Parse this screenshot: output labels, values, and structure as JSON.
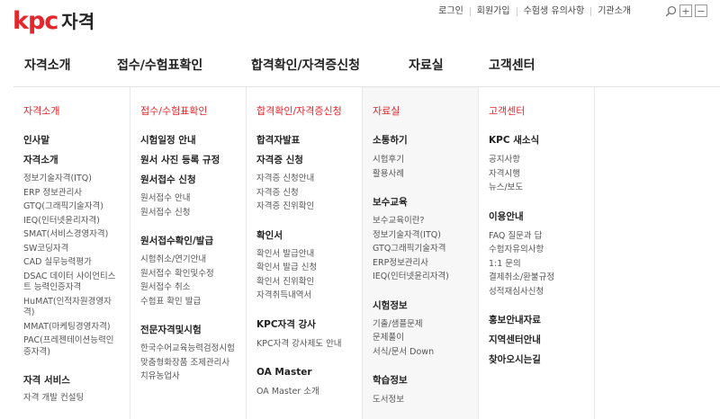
{
  "logo": {
    "mark": "kpc",
    "text": "자격"
  },
  "util_links": [
    "로그인",
    "회원가입",
    "수험생 유의사항",
    "기관소개"
  ],
  "gnb": [
    "자격소개",
    "접수/수험표확인",
    "합격확인/자격증신청",
    "자료실",
    "고객센터"
  ],
  "columns": [
    {
      "title": "자격소개",
      "groups": [
        {
          "heading": "인사말",
          "links": []
        },
        {
          "heading": "자격소개",
          "links": [
            "정보기술자격(ITQ)",
            "ERP 정보관리사",
            "GTQ(그래픽기술자격)",
            "IEQ(인터넷윤리자격)",
            "SMAT(서비스경영자격)",
            "SW코딩자격",
            "CAD 실무능력평가",
            "DSAC 데이터 사이언티스트 능력인증자격",
            "HuMAT(인적자원경영자격)",
            "MMAT(마케팅경영자격)",
            "PAC(프레젠테이션능력인증자격)"
          ]
        },
        {
          "heading": "자격 서비스",
          "links": [
            "자격 개발 컨설팅"
          ]
        }
      ]
    },
    {
      "title": "접수/수험표확인",
      "groups": [
        {
          "heading": "시험일정 안내",
          "links": []
        },
        {
          "heading": "원서 사진 등록 규정",
          "links": []
        },
        {
          "heading": "원서접수 신청",
          "links": [
            "원서접수 안내",
            "원서접수 신청"
          ]
        },
        {
          "heading": "원서접수확인/발급",
          "links": [
            "시험취소/연기안내",
            "원서접수 확인및수정",
            "원서접수 취소",
            "수험표 확인 발급"
          ]
        },
        {
          "heading": "전문자격및시험",
          "links": [
            "한국수어교육능력검정시험",
            "맞춤형화장품 조제관리사",
            "치유농업사"
          ]
        }
      ]
    },
    {
      "title": "합격확인/자격증신청",
      "groups": [
        {
          "heading": "합격자발표",
          "links": []
        },
        {
          "heading": "자격증 신청",
          "links": [
            "자격증 신청안내",
            "자격증 신청",
            "자격증 진위확인"
          ]
        },
        {
          "heading": "확인서",
          "links": [
            "확인서 발급안내",
            "확인서 발급 신청",
            "확인서 진위확인",
            "자격취득내역서"
          ]
        },
        {
          "heading": "KPC자격 강사",
          "links": [
            "KPC자격 강사제도 안내"
          ]
        },
        {
          "heading": "OA Master",
          "links": [
            "OA Master 소개"
          ]
        }
      ]
    },
    {
      "title": "자료실",
      "groups": [
        {
          "heading": "소통하기",
          "links": [
            "시험후기",
            "활용사례"
          ]
        },
        {
          "heading": "보수교육",
          "links": [
            "보수교육이란?",
            "정보기술자격(ITQ)",
            "GTQ그래픽기술자격",
            "ERP정보관리사",
            "IEQ(인터넷윤리자격)"
          ]
        },
        {
          "heading": "시험정보",
          "links": [
            "기출/샘플문제",
            "문제풀이",
            "서식/문서 Down"
          ]
        },
        {
          "heading": "학습정보",
          "links": [
            "도서정보"
          ]
        }
      ]
    },
    {
      "title": "고객센터",
      "groups": [
        {
          "heading": "KPC 새소식",
          "links": [
            "공지사항",
            "자격시행",
            "뉴스/보도"
          ]
        },
        {
          "heading": "이용안내",
          "links": [
            "FAQ 질문과 답",
            "수험자유의사항",
            "1:1 문의",
            "결제취소/환불규정",
            "성적재심사신청"
          ]
        },
        {
          "heading": "홍보안내자료",
          "links": []
        },
        {
          "heading": "지역센터안내",
          "links": []
        },
        {
          "heading": "찾아오시는길",
          "links": []
        }
      ]
    }
  ]
}
